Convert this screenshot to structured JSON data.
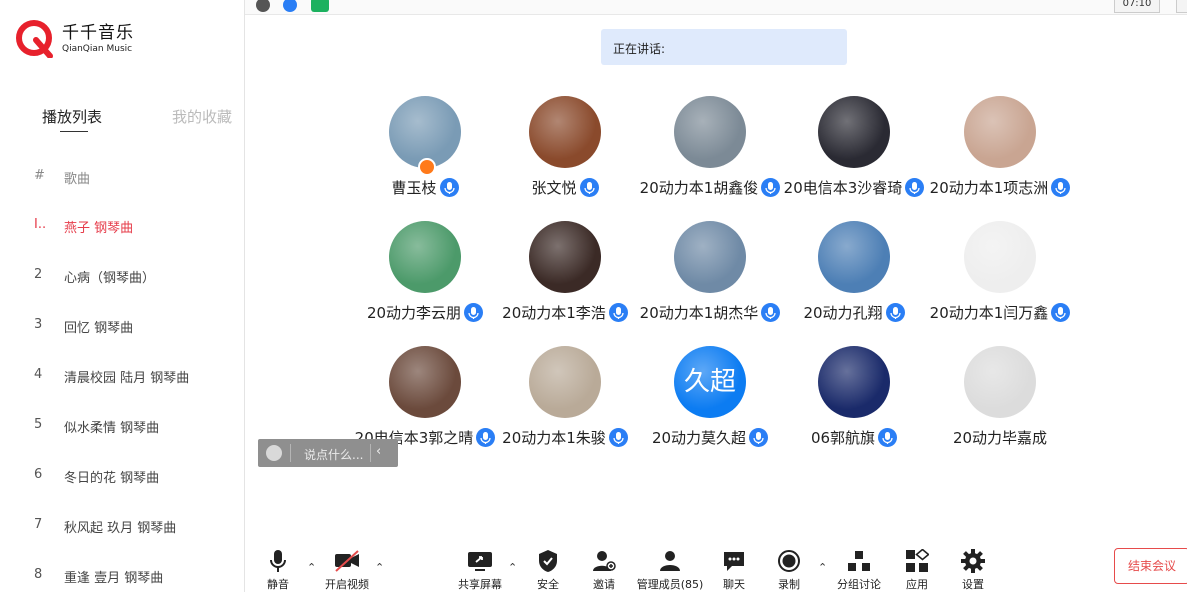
{
  "music": {
    "logo_cn": "千千音乐",
    "logo_en": "QianQian Music",
    "tabs": {
      "playlist": "播放列表",
      "favorites": "我的收藏"
    },
    "header": {
      "num": "#",
      "title": "歌曲"
    },
    "songs": [
      {
        "num": "I..",
        "title": "燕子 钢琴曲",
        "active": true
      },
      {
        "num": "2",
        "title": "心病（钢琴曲）"
      },
      {
        "num": "3",
        "title": "回忆 钢琴曲"
      },
      {
        "num": "4",
        "title": "清晨校园 陆月 钢琴曲"
      },
      {
        "num": "5",
        "title": "似水柔情 钢琴曲"
      },
      {
        "num": "6",
        "title": "冬日的花 钢琴曲"
      },
      {
        "num": "7",
        "title": "秋风起 玖月 钢琴曲"
      },
      {
        "num": "8",
        "title": "重逢 壹月 钢琴曲"
      }
    ]
  },
  "meeting": {
    "timer": "07:10",
    "speaking_label": "正在讲话:",
    "participants": [
      {
        "name": "曹玉枝",
        "color": "#7a9bb5",
        "host": true
      },
      {
        "name": "张文悦",
        "color": "#8a4a2c"
      },
      {
        "name": "20动力本1胡鑫俊",
        "color": "#7c8a96"
      },
      {
        "name": "20电信本3沙睿琦",
        "color": "#2a2a33"
      },
      {
        "name": "20动力本1项志洲",
        "color": "#c9a592"
      },
      {
        "name": "20动力李云朋",
        "color": "#4c9a6a"
      },
      {
        "name": "20动力本1李浩",
        "color": "#3b2a26"
      },
      {
        "name": "20动力本1胡杰华",
        "color": "#6f8aa6"
      },
      {
        "name": "20动力孔翔",
        "color": "#4d7fb5"
      },
      {
        "name": "20动力本1闫万鑫",
        "color": "#eeeeee"
      },
      {
        "name": "20电信本3郭之晴",
        "color": "#6b4a3c"
      },
      {
        "name": "20动力本1朱骏",
        "color": "#b9aa98"
      },
      {
        "name": "20动力莫久超",
        "color": "#0c7cf2",
        "avatar_text": "久超"
      },
      {
        "name": "06郭航旗",
        "color": "#1a2a6a"
      },
      {
        "name": "20动力毕嘉成",
        "color": "#dcdcdc",
        "no_mic": true
      }
    ],
    "chat_hint": "说点什么...",
    "chat_arrow": "‹",
    "toolbar": {
      "mute": "静音",
      "video": "开启视频",
      "share": "共享屏幕",
      "security": "安全",
      "invite": "邀请",
      "members": "管理成员(85)",
      "chat": "聊天",
      "record": "录制",
      "breakout": "分组讨论",
      "apps": "应用",
      "settings": "设置",
      "end": "结束会议"
    }
  }
}
